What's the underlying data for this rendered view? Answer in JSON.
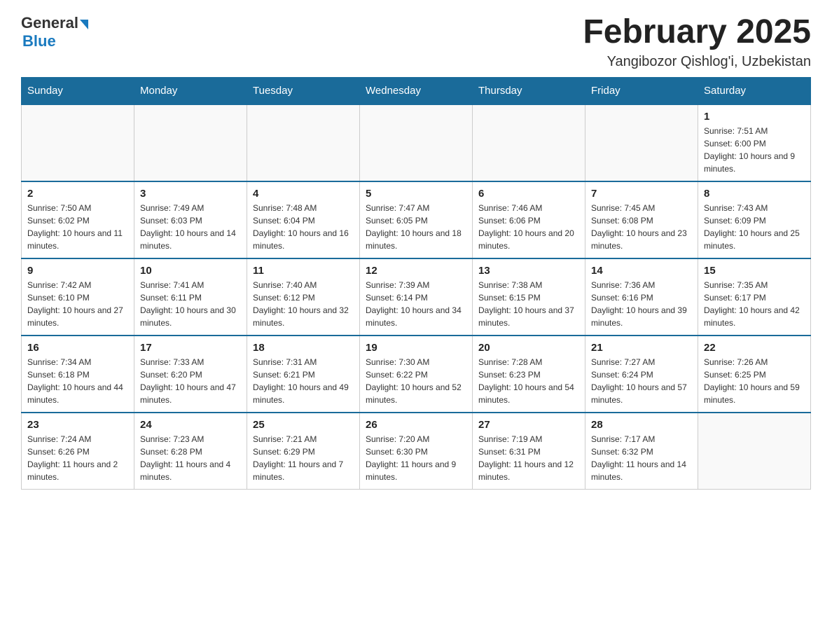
{
  "header": {
    "logo": {
      "general": "General",
      "blue": "Blue"
    },
    "title": "February 2025",
    "location": "Yangibozor Qishlog'i, Uzbekistan"
  },
  "weekdays": [
    "Sunday",
    "Monday",
    "Tuesday",
    "Wednesday",
    "Thursday",
    "Friday",
    "Saturday"
  ],
  "weeks": [
    [
      {
        "day": "",
        "info": ""
      },
      {
        "day": "",
        "info": ""
      },
      {
        "day": "",
        "info": ""
      },
      {
        "day": "",
        "info": ""
      },
      {
        "day": "",
        "info": ""
      },
      {
        "day": "",
        "info": ""
      },
      {
        "day": "1",
        "info": "Sunrise: 7:51 AM\nSunset: 6:00 PM\nDaylight: 10 hours and 9 minutes."
      }
    ],
    [
      {
        "day": "2",
        "info": "Sunrise: 7:50 AM\nSunset: 6:02 PM\nDaylight: 10 hours and 11 minutes."
      },
      {
        "day": "3",
        "info": "Sunrise: 7:49 AM\nSunset: 6:03 PM\nDaylight: 10 hours and 14 minutes."
      },
      {
        "day": "4",
        "info": "Sunrise: 7:48 AM\nSunset: 6:04 PM\nDaylight: 10 hours and 16 minutes."
      },
      {
        "day": "5",
        "info": "Sunrise: 7:47 AM\nSunset: 6:05 PM\nDaylight: 10 hours and 18 minutes."
      },
      {
        "day": "6",
        "info": "Sunrise: 7:46 AM\nSunset: 6:06 PM\nDaylight: 10 hours and 20 minutes."
      },
      {
        "day": "7",
        "info": "Sunrise: 7:45 AM\nSunset: 6:08 PM\nDaylight: 10 hours and 23 minutes."
      },
      {
        "day": "8",
        "info": "Sunrise: 7:43 AM\nSunset: 6:09 PM\nDaylight: 10 hours and 25 minutes."
      }
    ],
    [
      {
        "day": "9",
        "info": "Sunrise: 7:42 AM\nSunset: 6:10 PM\nDaylight: 10 hours and 27 minutes."
      },
      {
        "day": "10",
        "info": "Sunrise: 7:41 AM\nSunset: 6:11 PM\nDaylight: 10 hours and 30 minutes."
      },
      {
        "day": "11",
        "info": "Sunrise: 7:40 AM\nSunset: 6:12 PM\nDaylight: 10 hours and 32 minutes."
      },
      {
        "day": "12",
        "info": "Sunrise: 7:39 AM\nSunset: 6:14 PM\nDaylight: 10 hours and 34 minutes."
      },
      {
        "day": "13",
        "info": "Sunrise: 7:38 AM\nSunset: 6:15 PM\nDaylight: 10 hours and 37 minutes."
      },
      {
        "day": "14",
        "info": "Sunrise: 7:36 AM\nSunset: 6:16 PM\nDaylight: 10 hours and 39 minutes."
      },
      {
        "day": "15",
        "info": "Sunrise: 7:35 AM\nSunset: 6:17 PM\nDaylight: 10 hours and 42 minutes."
      }
    ],
    [
      {
        "day": "16",
        "info": "Sunrise: 7:34 AM\nSunset: 6:18 PM\nDaylight: 10 hours and 44 minutes."
      },
      {
        "day": "17",
        "info": "Sunrise: 7:33 AM\nSunset: 6:20 PM\nDaylight: 10 hours and 47 minutes."
      },
      {
        "day": "18",
        "info": "Sunrise: 7:31 AM\nSunset: 6:21 PM\nDaylight: 10 hours and 49 minutes."
      },
      {
        "day": "19",
        "info": "Sunrise: 7:30 AM\nSunset: 6:22 PM\nDaylight: 10 hours and 52 minutes."
      },
      {
        "day": "20",
        "info": "Sunrise: 7:28 AM\nSunset: 6:23 PM\nDaylight: 10 hours and 54 minutes."
      },
      {
        "day": "21",
        "info": "Sunrise: 7:27 AM\nSunset: 6:24 PM\nDaylight: 10 hours and 57 minutes."
      },
      {
        "day": "22",
        "info": "Sunrise: 7:26 AM\nSunset: 6:25 PM\nDaylight: 10 hours and 59 minutes."
      }
    ],
    [
      {
        "day": "23",
        "info": "Sunrise: 7:24 AM\nSunset: 6:26 PM\nDaylight: 11 hours and 2 minutes."
      },
      {
        "day": "24",
        "info": "Sunrise: 7:23 AM\nSunset: 6:28 PM\nDaylight: 11 hours and 4 minutes."
      },
      {
        "day": "25",
        "info": "Sunrise: 7:21 AM\nSunset: 6:29 PM\nDaylight: 11 hours and 7 minutes."
      },
      {
        "day": "26",
        "info": "Sunrise: 7:20 AM\nSunset: 6:30 PM\nDaylight: 11 hours and 9 minutes."
      },
      {
        "day": "27",
        "info": "Sunrise: 7:19 AM\nSunset: 6:31 PM\nDaylight: 11 hours and 12 minutes."
      },
      {
        "day": "28",
        "info": "Sunrise: 7:17 AM\nSunset: 6:32 PM\nDaylight: 11 hours and 14 minutes."
      },
      {
        "day": "",
        "info": ""
      }
    ]
  ]
}
